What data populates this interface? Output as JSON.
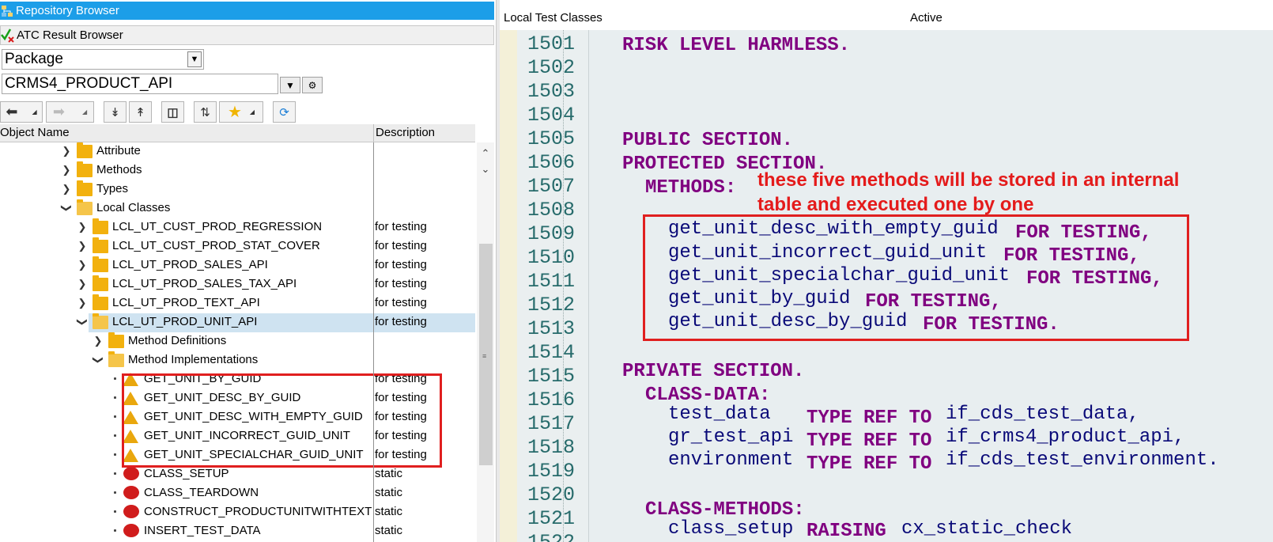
{
  "nav": {
    "repository_browser": "Repository Browser",
    "atc_result_browser": "ATC Result Browser"
  },
  "selector": {
    "object_type": "Package",
    "package_name": "CRMS4_PRODUCT_API"
  },
  "tree": {
    "header_name": "Object Name",
    "header_desc": "Description",
    "rows": [
      {
        "label": "Attribute",
        "desc": ""
      },
      {
        "label": "Methods",
        "desc": ""
      },
      {
        "label": "Types",
        "desc": ""
      },
      {
        "label": "Local Classes",
        "desc": ""
      },
      {
        "label": "LCL_UT_CUST_PROD_REGRESSION",
        "desc": "for testing"
      },
      {
        "label": "LCL_UT_CUST_PROD_STAT_COVER",
        "desc": "for testing"
      },
      {
        "label": "LCL_UT_PROD_SALES_API",
        "desc": "for testing"
      },
      {
        "label": "LCL_UT_PROD_SALES_TAX_API",
        "desc": "for testing"
      },
      {
        "label": "LCL_UT_PROD_TEXT_API",
        "desc": "for testing"
      },
      {
        "label": "LCL_UT_PROD_UNIT_API",
        "desc": "for testing"
      },
      {
        "label": "Method Definitions",
        "desc": ""
      },
      {
        "label": "Method Implementations",
        "desc": ""
      },
      {
        "label": "GET_UNIT_BY_GUID",
        "desc": "for testing"
      },
      {
        "label": "GET_UNIT_DESC_BY_GUID",
        "desc": "for testing"
      },
      {
        "label": "GET_UNIT_DESC_WITH_EMPTY_GUID",
        "desc": "for testing"
      },
      {
        "label": "GET_UNIT_INCORRECT_GUID_UNIT",
        "desc": "for testing"
      },
      {
        "label": "GET_UNIT_SPECIALCHAR_GUID_UNIT",
        "desc": "for testing"
      },
      {
        "label": "CLASS_SETUP",
        "desc": "static"
      },
      {
        "label": "CLASS_TEARDOWN",
        "desc": "static"
      },
      {
        "label": "CONSTRUCT_PRODUCTUNITWITHTEXT",
        "desc": "static"
      },
      {
        "label": "INSERT_TEST_DATA",
        "desc": "static"
      }
    ]
  },
  "editor": {
    "title": "Local Test Classes",
    "status": "Active",
    "line_numbers": [
      "1501",
      "1502",
      "1503",
      "1504",
      "1505",
      "1506",
      "1507",
      "1508",
      "1509",
      "1510",
      "1511",
      "1512",
      "1513",
      "1514",
      "1515",
      "1516",
      "1517",
      "1518",
      "1519",
      "1520",
      "1521",
      "1522"
    ],
    "code": {
      "l1501": "RISK LEVEL HARMLESS.",
      "l1505": "PUBLIC SECTION.",
      "l1506": "PROTECTED SECTION.",
      "l1507": "METHODS:",
      "l1509_id": "get_unit_desc_with_empty_guid",
      "l1510_id": "get_unit_incorrect_guid_unit",
      "l1511_id": "get_unit_specialchar_guid_unit",
      "l1512_id": "get_unit_by_guid",
      "l1513_id": "get_unit_desc_by_guid",
      "for_testing_comma": "FOR TESTING,",
      "for_testing_dot": "FOR TESTING.",
      "l1515": "PRIVATE SECTION.",
      "l1516": "CLASS-DATA:",
      "l1517_id": "test_data",
      "l1518_id": "gr_test_api",
      "l1519_id": "environment",
      "type_ref_to": "TYPE REF TO",
      "l1517_type": "if_cds_test_data,",
      "l1518_type": "if_crms4_product_api,",
      "l1519_type": "if_cds_test_environment.",
      "l1521": "CLASS-METHODS:",
      "l1522_id": "class_setup",
      "l1522_kw": "RAISING",
      "l1522_type": "cx_static_check"
    },
    "annotation_line1": "these five methods will be stored in an internal",
    "annotation_line2": "table and executed one by one"
  }
}
